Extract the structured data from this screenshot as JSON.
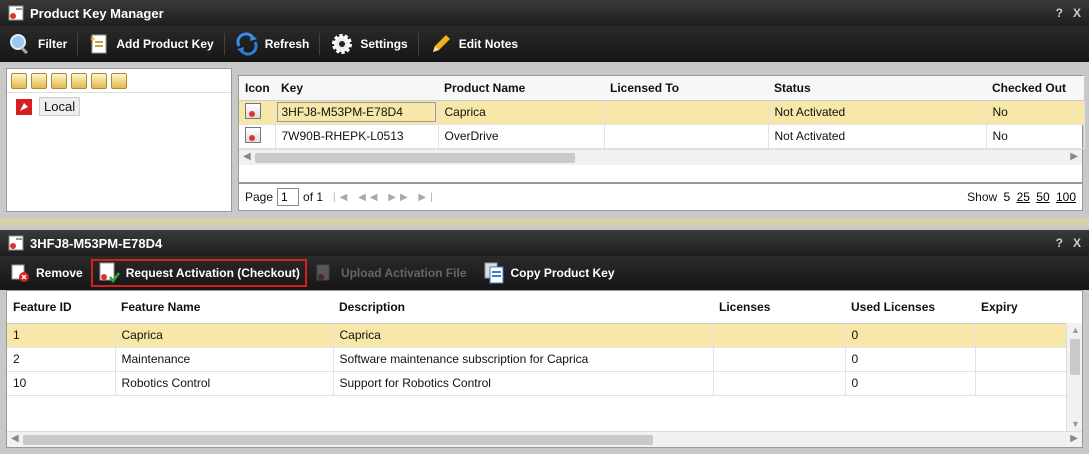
{
  "window": {
    "title": "Product Key Manager",
    "help": "?",
    "close": "X"
  },
  "toolbar": {
    "filter": "Filter",
    "add_product_key": "Add Product Key",
    "refresh": "Refresh",
    "settings": "Settings",
    "edit_notes": "Edit Notes"
  },
  "tree": {
    "node_label": "Local"
  },
  "keys_table": {
    "columns": [
      "Icon",
      "Key",
      "Product Name",
      "Licensed To",
      "Status",
      "Checked Out"
    ],
    "rows": [
      {
        "key": "3HFJ8-M53PM-E78D4",
        "product": "Caprica",
        "licensed_to": "",
        "status": "Not Activated",
        "checked_out": "No"
      },
      {
        "key": "7W90B-RHEPK-L0513",
        "product": "OverDrive",
        "licensed_to": "",
        "status": "Not Activated",
        "checked_out": "No"
      }
    ]
  },
  "pager": {
    "page_label": "Page",
    "page_value": "1",
    "of_label": "of 1",
    "show_label": "Show",
    "sizes": [
      "5",
      "25",
      "50",
      "100"
    ]
  },
  "detail": {
    "title": "3HFJ8-M53PM-E78D4",
    "help": "?",
    "close": "X",
    "toolbar": {
      "remove": "Remove",
      "request_activation": "Request Activation (Checkout)",
      "upload_activation_file": "Upload Activation File",
      "copy_product_key": "Copy Product Key"
    }
  },
  "features_table": {
    "columns": [
      "Feature ID",
      "Feature Name",
      "Description",
      "Licenses",
      "Used Licenses",
      "Expiry"
    ],
    "rows": [
      {
        "id": "1",
        "name": "Caprica",
        "description": "Caprica",
        "licenses": "",
        "used": "0",
        "expiry": ""
      },
      {
        "id": "2",
        "name": "Maintenance",
        "description": "Software maintenance subscription for Caprica",
        "licenses": "",
        "used": "0",
        "expiry": ""
      },
      {
        "id": "10",
        "name": "Robotics Control",
        "description": "Support for Robotics Control",
        "licenses": "",
        "used": "0",
        "expiry": ""
      }
    ]
  },
  "colors": {
    "selected_row": "#f7e7a8",
    "highlight_box": "#d62020",
    "titlebar": "#2a2a2a"
  }
}
